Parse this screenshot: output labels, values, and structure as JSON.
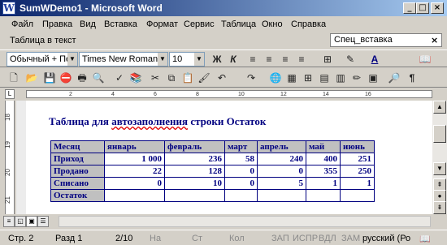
{
  "window": {
    "title": "SumWDemo1 - Microsoft Word",
    "icon": "word-document-icon"
  },
  "menu": [
    "Файл",
    "Правка",
    "Вид",
    "Вставка",
    "Формат",
    "Сервис",
    "Таблица",
    "Окно",
    "Справка",
    "Спец_вставка"
  ],
  "taskpane": {
    "label": "Таблица в текст"
  },
  "format_toolbar": {
    "style": "Обычный + Пер",
    "font": "Times New Roman",
    "size": "10",
    "bold": "Ж",
    "italic": "К"
  },
  "ruler": {
    "marks": [
      "2",
      "4",
      "6",
      "8",
      "10",
      "12",
      "14",
      "16"
    ]
  },
  "vruler": {
    "marks": [
      "18",
      "19",
      "20",
      "21"
    ]
  },
  "document": {
    "heading_prefix": "Таблица для ",
    "heading_misspelled": "автозаполнения",
    "heading_suffix": " строки Остаток",
    "table": {
      "header": [
        "Месяц",
        "январь",
        "февраль",
        "март",
        "апрель",
        "май",
        "июнь"
      ],
      "rows": [
        [
          "Приход",
          "1 000",
          "236",
          "58",
          "240",
          "400",
          "251"
        ],
        [
          "Продано",
          "22",
          "128",
          "0",
          "0",
          "355",
          "250"
        ],
        [
          "Списано",
          "0",
          "10",
          "0",
          "5",
          "1",
          "1"
        ],
        [
          "Остаток",
          "",
          "",
          "",
          "",
          "",
          ""
        ]
      ]
    }
  },
  "statusbar": {
    "page": "Стр. 2",
    "section": "Разд 1",
    "pages": "2/10",
    "at": "На",
    "line": "Ст",
    "col": "Кол",
    "rec": "ЗАП",
    "trk": "ИСПР",
    "ext": "ВДЛ",
    "ovr": "ЗАМ",
    "language": "русский (Ро"
  }
}
